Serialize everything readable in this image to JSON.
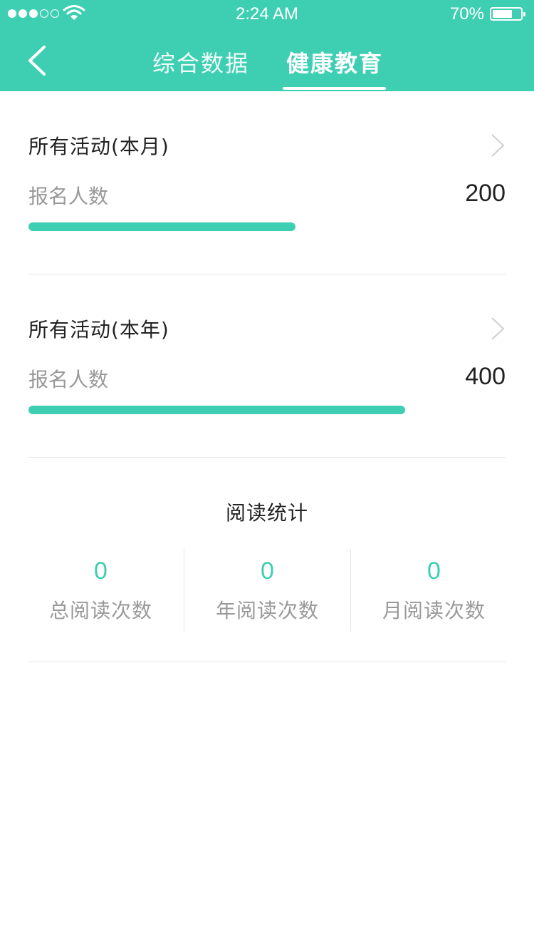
{
  "status_bar": {
    "time": "2:24 AM",
    "battery": "70%",
    "battery_level": 0.7,
    "signal_bars_filled": 3,
    "signal_bars_total": 5
  },
  "nav": {
    "back_icon": "chevron-left-icon",
    "tabs": [
      {
        "label": "综合数据",
        "active": false
      },
      {
        "label": "健康教育",
        "active": true
      }
    ]
  },
  "activities": [
    {
      "title": "所有活动(本月)",
      "label": "报名人数",
      "value": "200",
      "progress": 0.56
    },
    {
      "title": "所有活动(本年)",
      "label": "报名人数",
      "value": "400",
      "progress": 0.79
    }
  ],
  "reading": {
    "title": "阅读统计",
    "stats": [
      {
        "value": "0",
        "label": "总阅读次数"
      },
      {
        "value": "0",
        "label": "年阅读次数"
      },
      {
        "value": "0",
        "label": "月阅读次数"
      }
    ]
  },
  "colors": {
    "accent": "#3ecfb3",
    "text_primary": "#222222",
    "text_secondary": "#999999",
    "divider": "#e6e6e6"
  }
}
